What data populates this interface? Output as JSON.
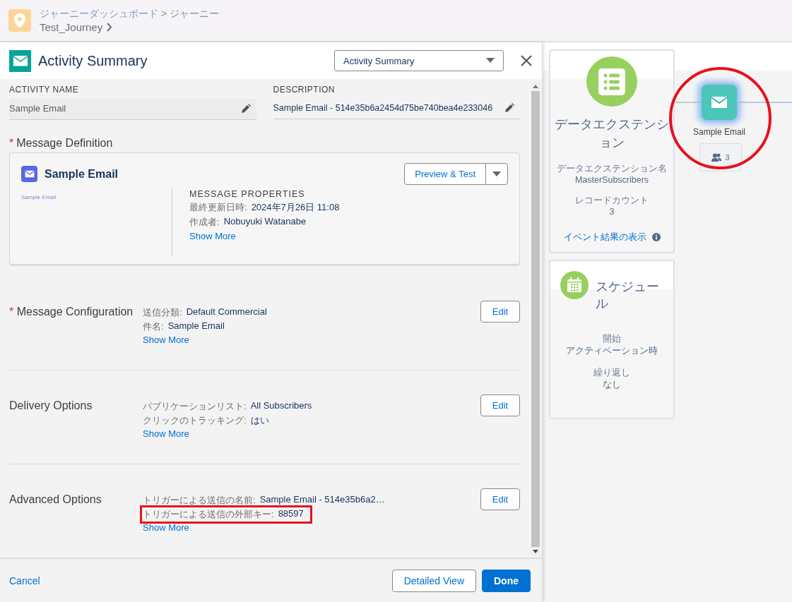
{
  "header": {
    "breadcrumb_parent": "ジャーニーダッシュボード",
    "breadcrumb_separator": ">",
    "breadcrumb_current": "ジャーニー",
    "journey_name": "Test_Journey"
  },
  "panel": {
    "title": "Activity Summary",
    "view_select": "Activity Summary",
    "activity_name": {
      "label": "ACTIVITY NAME",
      "value": "Sample Email"
    },
    "description": {
      "label": "DESCRIPTION",
      "value": "Sample Email - 514e35b6a2454d75be740bea4e233046"
    },
    "message_definition": {
      "required_mark": "*",
      "label": "Message Definition",
      "email_name": "Sample Email",
      "preview_button": "Preview & Test",
      "thumbnail_text": "Sample Email",
      "properties_heading": "MESSAGE PROPERTIES",
      "properties": [
        {
          "label": "最終更新日時:",
          "value": "2024年7月26日 11:08"
        },
        {
          "label": "作成者:",
          "value": "Nobuyuki Watanabe"
        }
      ],
      "show_more": "Show More"
    },
    "sections": [
      {
        "required_mark": "*",
        "title": "Message Configuration",
        "lines": [
          {
            "label": "送信分類:",
            "value": "Default Commercial",
            "highlighted": false
          },
          {
            "label": "件名:",
            "value": "Sample Email",
            "highlighted": false
          }
        ],
        "show_more": "Show More",
        "edit_button": "Edit"
      },
      {
        "title": "Delivery Options",
        "lines": [
          {
            "label": "パブリケーションリスト:",
            "value": "All Subscribers",
            "highlighted": false
          },
          {
            "label": "クリックのトラッキング:",
            "value": "はい",
            "highlighted": false
          }
        ],
        "show_more": "Show More",
        "edit_button": "Edit"
      },
      {
        "title": "Advanced Options",
        "lines": [
          {
            "label": "トリガーによる送信の名前:",
            "value": "Sample Email - 514e35b6a2…",
            "highlighted": false
          },
          {
            "label": "トリガーによる送信の外部キー:",
            "value": "88597",
            "highlighted": true
          }
        ],
        "show_more": "Show More",
        "edit_button": "Edit"
      }
    ],
    "footer": {
      "cancel": "Cancel",
      "detailed_view": "Detailed View",
      "done": "Done"
    }
  },
  "canvas": {
    "entry_card": {
      "title": "データエクステンション",
      "fields": [
        {
          "label": "データエクステンション名",
          "value": "MasterSubscribers"
        },
        {
          "label": "レコードカウント",
          "value": "3"
        }
      ],
      "link": "イベント結果の表示"
    },
    "schedule_card": {
      "title": "スケジュール",
      "fields": [
        {
          "label": "開始",
          "value": "アクティベーション時"
        },
        {
          "label": "繰り返し",
          "value": "なし"
        }
      ]
    },
    "email_node": {
      "label": "Sample Email",
      "count": "3",
      "highlighted": true
    }
  }
}
